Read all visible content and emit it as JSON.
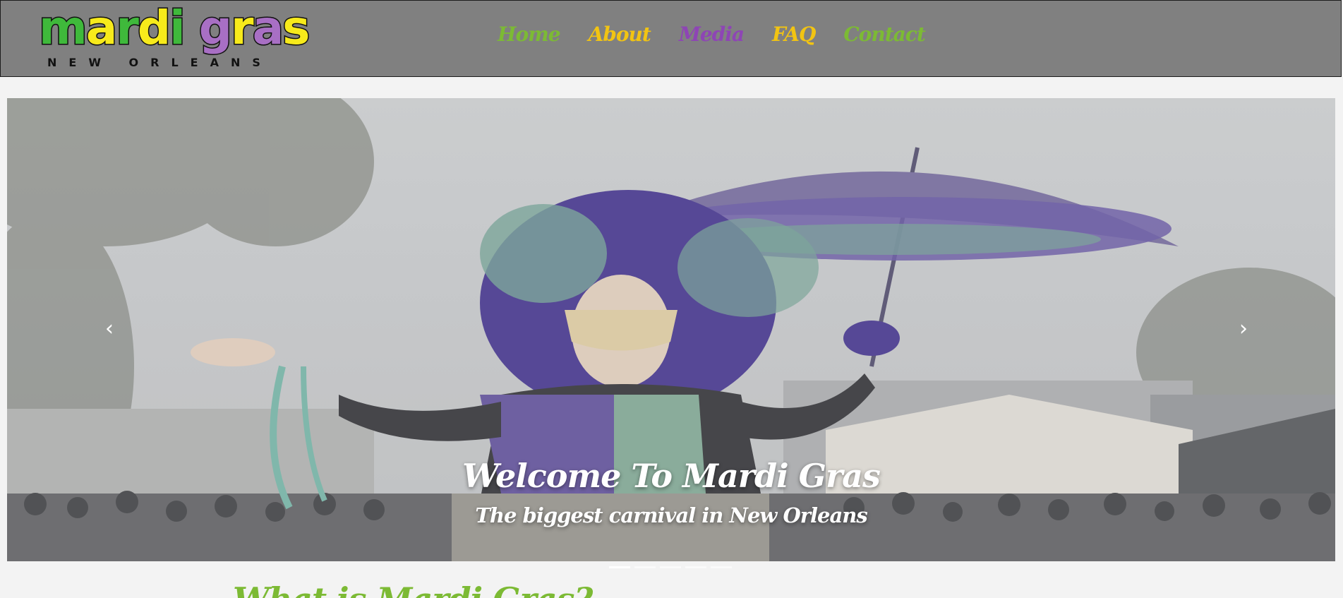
{
  "logo": {
    "letters": [
      {
        "ch": "m",
        "color": "#3fb93b"
      },
      {
        "ch": "a",
        "color": "#f7ea1b"
      },
      {
        "ch": "r",
        "color": "#3fb93b"
      },
      {
        "ch": "d",
        "color": "#f7ea1b"
      },
      {
        "ch": "i",
        "color": "#3fb93b"
      },
      {
        "ch": " ",
        "color": "#000000"
      },
      {
        "ch": "g",
        "color": "#a86fc4"
      },
      {
        "ch": "r",
        "color": "#f7ea1b"
      },
      {
        "ch": "a",
        "color": "#a86fc4"
      },
      {
        "ch": "s",
        "color": "#f7ea1b"
      }
    ],
    "subtitle": "NEW ORLEANS"
  },
  "nav": {
    "items": [
      {
        "label": "Home",
        "color": "#7cba34"
      },
      {
        "label": "About",
        "color": "#f2c412"
      },
      {
        "label": "Media",
        "color": "#8e45b5"
      },
      {
        "label": "FAQ",
        "color": "#f2c412"
      },
      {
        "label": "Contact",
        "color": "#7cba34"
      }
    ]
  },
  "carousel": {
    "prev_icon": "chevron-left-icon",
    "next_icon": "chevron-right-icon",
    "prev_glyph": "‹",
    "next_glyph": "›",
    "title": "Welcome To Mardi Gras",
    "subtitle": "The biggest carnival in New Orleans",
    "slide_count": 5,
    "active_slide": 1
  },
  "section": {
    "heading": "What is Mardi Gras?"
  }
}
